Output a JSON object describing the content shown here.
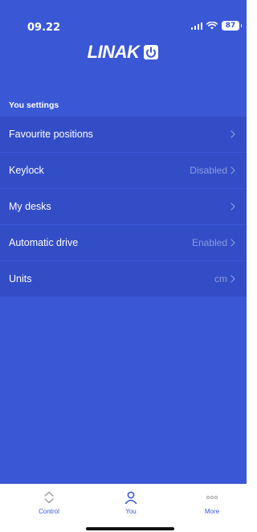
{
  "status_bar": {
    "time": "09.22",
    "battery": "87"
  },
  "header": {
    "logo_text": "LINAK"
  },
  "section": {
    "title": "You settings"
  },
  "settings": [
    {
      "label": "Favourite positions",
      "value": ""
    },
    {
      "label": "Keylock",
      "value": "Disabled"
    },
    {
      "label": "My desks",
      "value": ""
    },
    {
      "label": "Automatic drive",
      "value": "Enabled"
    },
    {
      "label": "Units",
      "value": "cm"
    }
  ],
  "tab_bar": {
    "tabs": [
      {
        "label": "Control",
        "icon": "up-down-chevrons-icon"
      },
      {
        "label": "You",
        "icon": "person-icon",
        "active": true
      },
      {
        "label": "More",
        "icon": "ellipsis-icon"
      }
    ]
  },
  "colors": {
    "background": "#3a57d6",
    "row": "#334dc6",
    "accent": "#3a57d6",
    "value_text": "#8a9be0"
  }
}
